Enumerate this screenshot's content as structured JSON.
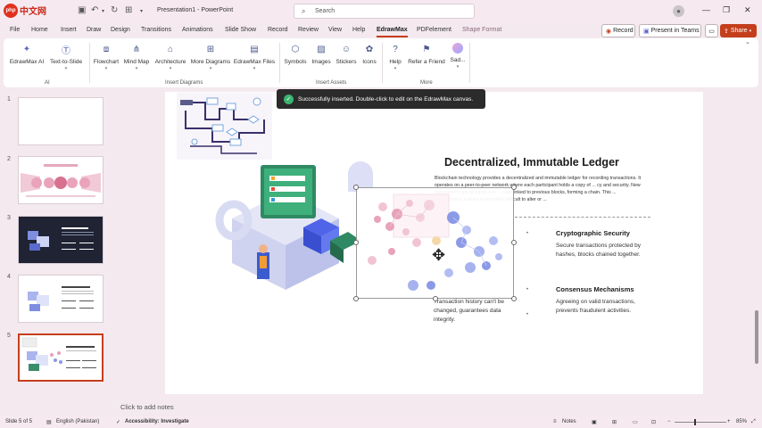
{
  "app": {
    "logo_text": "中文网",
    "logo_badge": "php",
    "window_title": "Presentation1 - PowerPoint",
    "search_placeholder": "Search"
  },
  "menu_tabs": [
    "File",
    "Home",
    "Insert",
    "Draw",
    "Design",
    "Transitions",
    "Animations",
    "Slide Show",
    "Record",
    "Review",
    "View",
    "Help",
    "EdrawMax",
    "PDFelement",
    "Shape Format"
  ],
  "active_tab": "EdrawMax",
  "top_buttons": {
    "record": "Record",
    "present_in_teams": "Present in Teams",
    "share": "Share"
  },
  "ribbon": {
    "buttons": [
      {
        "label": "EdrawMax AI",
        "icon": "ai-icon"
      },
      {
        "label": "Text-to-Slide",
        "icon": "text-to-slide-icon"
      },
      {
        "label": "Flowchart",
        "icon": "flowchart-icon"
      },
      {
        "label": "Mind Map",
        "icon": "mind-map-icon"
      },
      {
        "label": "Architecture",
        "icon": "architecture-icon"
      },
      {
        "label": "More Diagrams",
        "icon": "more-diagrams-icon"
      },
      {
        "label": "EdrawMax Files",
        "icon": "files-icon"
      },
      {
        "label": "Symbols",
        "icon": "symbols-icon"
      },
      {
        "label": "Images",
        "icon": "images-icon"
      },
      {
        "label": "Stickers",
        "icon": "stickers-icon"
      },
      {
        "label": "Icons",
        "icon": "icons-icon"
      },
      {
        "label": "Help",
        "icon": "help-icon"
      },
      {
        "label": "Refer a Friend",
        "icon": "refer-friend-icon"
      },
      {
        "label": "Sad...",
        "icon": "sad-icon"
      }
    ],
    "groups": [
      "AI",
      "Insert Diagrams",
      "Insert Assets",
      "More"
    ]
  },
  "toast": "Successfully inserted. Double-click to edit on the EdrawMax canvas.",
  "thumbnails": [
    "1",
    "2",
    "3",
    "4",
    "5"
  ],
  "slide": {
    "title": "Decentralized, Immutable Ledger",
    "body": "Blockchain technology provides a decentralized and immutable ledger for recording transactions. It operates on a peer-to-peer network where each participant holds a copy of ... cy and security. New transactions are grouped into ... cally linked to previous blocks, forming a chain. This ... mechanisms, making it extremely difficult to alter or ...",
    "crypto_heading": "Cryptographic Security",
    "crypto_text": "Secure transactions protected by hashes, blocks chained together.",
    "consensus_heading": "Consensus Mechanisms",
    "consensus_text": "Agreeing on valid transactions, prevents fraudulent activities.",
    "immutable_text": "Transaction history can't be changed, guarantees data integrity."
  },
  "notes_placeholder": "Click to add notes",
  "status": {
    "slide_of": "Slide 5 of 5",
    "language": "English (Pakistan)",
    "accessibility": "Accessibility: Investigate",
    "notes": "Notes",
    "zoom": "85%"
  },
  "colors": {
    "accent": "#c43e1c",
    "titlebar_bg": "#f6eaf0",
    "toast_bg": "#2b2b2b"
  }
}
